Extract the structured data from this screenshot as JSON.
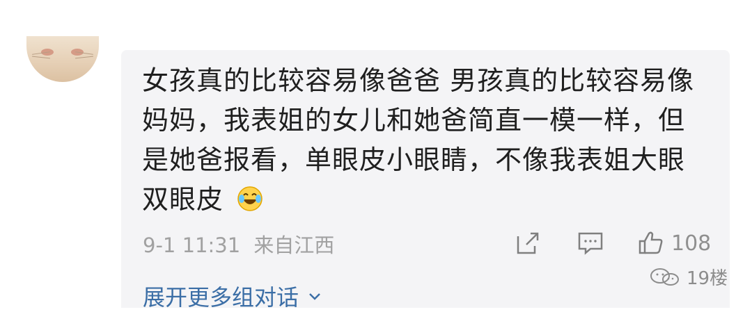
{
  "comment": {
    "text_lines": [
      "女孩真的比较容易像爸爸 男孩真的比较容易像",
      "妈妈，我表姐的女儿和她爸简直一模一样，但",
      "是她爸报看，单眼皮小眼睛，不像我表姐大眼",
      "双眼皮"
    ],
    "emoji_icon": "laughing-tears-emoji",
    "time": "9-1 11:31",
    "location": "来自江西",
    "likes": "108",
    "expand_label": "展开更多组对话"
  },
  "actions": {
    "share_icon": "share-icon",
    "comment_icon": "comment-icon",
    "like_icon": "like-icon"
  },
  "watermark": {
    "text": "19楼"
  },
  "colors": {
    "card_bg": "#f4f4f6",
    "text": "#1f1f1f",
    "meta": "#a1a1a1",
    "link": "#3b6ea6"
  }
}
